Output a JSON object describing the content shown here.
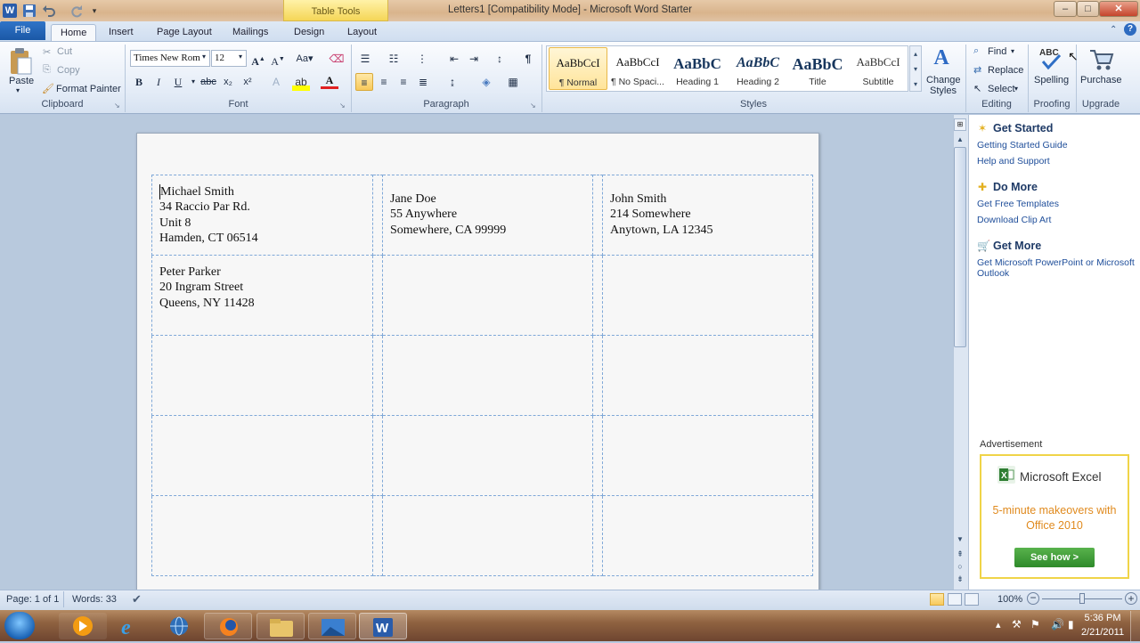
{
  "window": {
    "title": "Letters1 [Compatibility Mode]  -  Microsoft Word Starter",
    "context_tab": "Table Tools",
    "controls": [
      "–",
      "□",
      "✕"
    ]
  },
  "tabs": [
    "File",
    "Home",
    "Insert",
    "Page Layout",
    "Mailings",
    "Design",
    "Layout"
  ],
  "ribbon": {
    "clipboard": {
      "paste": "Paste",
      "cut": "Cut",
      "copy": "Copy",
      "format_painter": "Format Painter",
      "label": "Clipboard"
    },
    "font": {
      "name": "Times New Rom",
      "size": "12",
      "label": "Font"
    },
    "paragraph": {
      "label": "Paragraph"
    },
    "styles": {
      "items": [
        {
          "sample": "AaBbCcI",
          "name": "¶ Normal"
        },
        {
          "sample": "AaBbCcI",
          "name": "¶ No Spaci..."
        },
        {
          "sample": "AaBbC",
          "name": "Heading 1"
        },
        {
          "sample": "AaBbC",
          "name": "Heading 2"
        },
        {
          "sample": "AaBbC",
          "name": "Title"
        },
        {
          "sample": "AaBbCcI",
          "name": "Subtitle"
        }
      ],
      "change_styles": "Change Styles",
      "label": "Styles"
    },
    "editing": {
      "find": "Find",
      "replace": "Replace",
      "select": "Select",
      "label": "Editing"
    },
    "proofing": {
      "spelling": "Spelling",
      "label": "Proofing"
    },
    "upgrade": {
      "purchase": "Purchase",
      "label": "Upgrade"
    }
  },
  "labels": [
    [
      "Michael Smith",
      "34 Raccio Par Rd.",
      "Unit 8",
      "Hamden, CT 06514"
    ],
    [
      "Jane Doe",
      "55 Anywhere",
      "Somewhere, CA 99999"
    ],
    [
      "John Smith",
      "214 Somewhere",
      "Anytown, LA 12345"
    ],
    [
      "Peter Parker",
      "20 Ingram Street",
      "Queens, NY 11428"
    ]
  ],
  "pane": {
    "get_started": "Get Started",
    "getting_started_guide": "Getting Started Guide",
    "help_support": "Help and Support",
    "do_more": "Do More",
    "free_templates": "Get Free Templates",
    "clip_art": "Download Clip Art",
    "get_more": "Get More",
    "get_ms": "Get Microsoft PowerPoint or Microsoft Outlook",
    "ad_label": "Advertisement",
    "ad_product": "Microsoft Excel",
    "ad_text": "5-minute makeovers with Office 2010",
    "ad_button": "See how >"
  },
  "status": {
    "page": "Page: 1 of 1",
    "words": "Words: 33",
    "zoom": "100%"
  },
  "clock": {
    "time": "5:36 PM",
    "date": "2/21/2011"
  },
  "colors": {
    "file_tab": "#1f5fb0",
    "table_tools": "#f5d657",
    "doc_bg": "#b8c9dd"
  }
}
